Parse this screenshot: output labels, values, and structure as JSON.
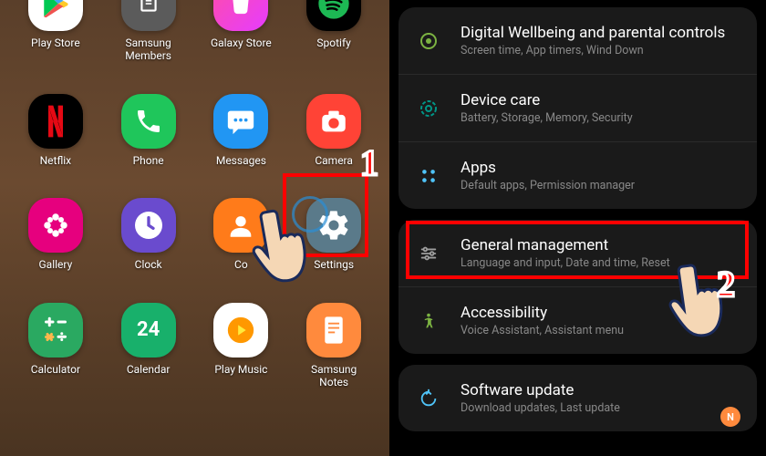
{
  "apps": {
    "r1c1": "Play Store",
    "r1c2": "Samsung\nMembers",
    "r1c3": "Galaxy Store",
    "r1c4": "Spotify",
    "r2c1": "Netflix",
    "r2c2": "Phone",
    "r2c3": "Messages",
    "r2c4": "Camera",
    "r3c1": "Gallery",
    "r3c2": "Clock",
    "r3c3": "Co",
    "r3c4": "Settings",
    "r4c1": "Calculator",
    "r4c2": "Calendar",
    "r4c3": "Play Music",
    "r4c4": "Samsung\nNotes"
  },
  "settings": {
    "wellbeing": {
      "title": "Digital Wellbeing and parental controls",
      "sub": "Screen time, App timers, Wind Down"
    },
    "devicecare": {
      "title": "Device care",
      "sub": "Battery, Storage, Memory, Security"
    },
    "apps": {
      "title": "Apps",
      "sub": "Default apps, Permission manager"
    },
    "general": {
      "title": "General management",
      "sub": "Language and input, Date and time, Reset"
    },
    "accessibility": {
      "title": "Accessibility",
      "sub": "Voice Assistant, Assistant menu"
    },
    "software": {
      "title": "Software update",
      "sub": "Download updates, Last update"
    }
  },
  "annotations": {
    "step1": "1",
    "step2": "2",
    "notification_badge": "N",
    "calendar_day": "24"
  }
}
